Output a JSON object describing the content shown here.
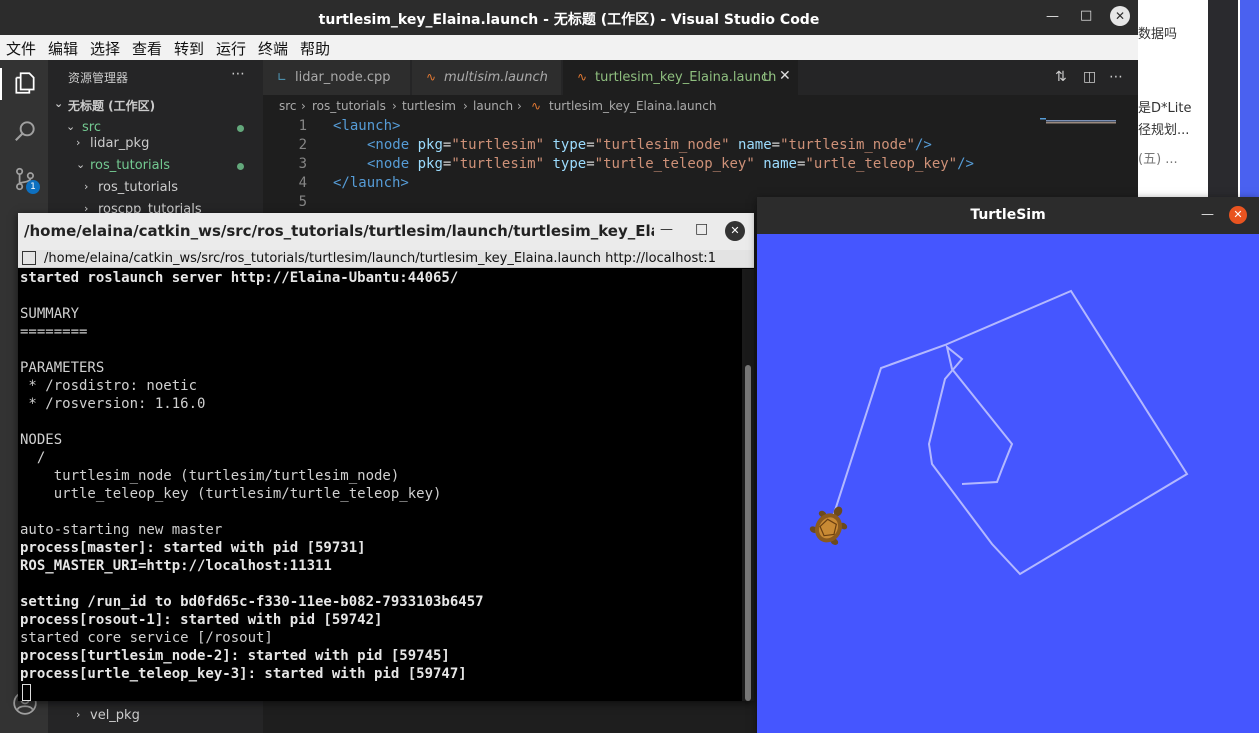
{
  "background_browser": {
    "snippets": [
      "数据吗",
      "是D*Lite",
      "径规划...",
      "(五) ..."
    ]
  },
  "vscode": {
    "title": "turtlesim_key_Elaina.launch - 无标题 (工作区) - Visual Studio Code",
    "menu": [
      "文件",
      "编辑",
      "选择",
      "查看",
      "转到",
      "运行",
      "终端",
      "帮助"
    ],
    "activity_badge": "1",
    "sidebar": {
      "header": "资源管理器",
      "workspace": "无标题 (工作区)",
      "items": [
        "src",
        "lidar_pkg",
        "ros_tutorials",
        "ros_tutorials",
        "roscpp_tutorials",
        "vel_pkg"
      ]
    },
    "tabs": [
      {
        "label": "lidar_node.cpp",
        "icon": "cpp-file-icon"
      },
      {
        "label": "multisim.launch",
        "icon": "rss-file-icon"
      },
      {
        "label": "turtlesim_key_Elaina.launch",
        "icon": "rss-file-icon",
        "status": "U"
      }
    ],
    "breadcrumb": [
      "src",
      "ros_tutorials",
      "turtlesim",
      "launch",
      "turtlesim_key_Elaina.launch"
    ],
    "line_numbers": [
      "1",
      "2",
      "3",
      "4",
      "5"
    ],
    "code": {
      "l1_tag": "<launch>",
      "l2": {
        "open": "<node",
        "a1": "pkg",
        "v1": "\"turtlesim\"",
        "a2": "type",
        "v2": "\"turtlesim_node\"",
        "a3": "name",
        "v3": "\"turtlesim_node\"",
        "close": "/>"
      },
      "l3": {
        "open": "<node",
        "a1": "pkg",
        "v1": "\"turtlesim\"",
        "a2": "type",
        "v2": "\"turtle_teleop_key\"",
        "a3": "name",
        "v3": "\"urtle_teleop_key\"",
        "close": "/>"
      },
      "l4_tag": "</launch>"
    }
  },
  "terminal": {
    "title": "/home/elaina/catkin_ws/src/ros_tutorials/turtlesim/launch/turtlesim_key_Elaina.laun...",
    "tab_text": "/home/elaina/catkin_ws/src/ros_tutorials/turtlesim/launch/turtlesim_key_Elaina.launch http://localhost:1",
    "lines": [
      {
        "text": "started roslaunch server http://Elaina-Ubantu:44065/",
        "bold": true
      },
      {
        "text": "",
        "bold": false
      },
      {
        "text": "SUMMARY",
        "bold": false
      },
      {
        "text": "========",
        "bold": false
      },
      {
        "text": "",
        "bold": false
      },
      {
        "text": "PARAMETERS",
        "bold": false
      },
      {
        "text": " * /rosdistro: noetic",
        "bold": false
      },
      {
        "text": " * /rosversion: 1.16.0",
        "bold": false
      },
      {
        "text": "",
        "bold": false
      },
      {
        "text": "NODES",
        "bold": false
      },
      {
        "text": "  /",
        "bold": false
      },
      {
        "text": "    turtlesim_node (turtlesim/turtlesim_node)",
        "bold": false
      },
      {
        "text": "    urtle_teleop_key (turtlesim/turtle_teleop_key)",
        "bold": false
      },
      {
        "text": "",
        "bold": false
      },
      {
        "text": "auto-starting new master",
        "bold": false
      },
      {
        "text": "process[master]: started with pid [59731]",
        "bold": true
      },
      {
        "text": "ROS_MASTER_URI=http://localhost:11311",
        "bold": true
      },
      {
        "text": "",
        "bold": false
      },
      {
        "text": "setting /run_id to bd0fd65c-f330-11ee-b082-7933103b6457",
        "bold": true
      },
      {
        "text": "process[rosout-1]: started with pid [59742]",
        "bold": true
      },
      {
        "text": "started core service [/rosout]",
        "bold": false
      },
      {
        "text": "process[turtlesim_node-2]: started with pid [59745]",
        "bold": true
      },
      {
        "text": "process[urtle_teleop_key-3]: started with pid [59747]",
        "bold": true
      }
    ]
  },
  "turtlesim": {
    "title": "TurtleSim",
    "background_color": "#4556ff",
    "path_color": "#b3b8ff"
  }
}
